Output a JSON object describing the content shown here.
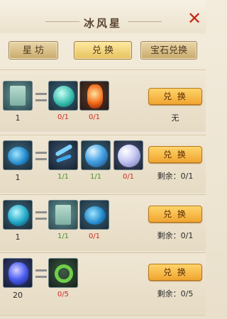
{
  "title": "冰风星",
  "close_icon": "close-icon",
  "tabs": [
    {
      "label": "星 坊"
    },
    {
      "label": "兑 换",
      "active": true
    },
    {
      "label": "宝石兑换"
    }
  ],
  "colors": {
    "accent": "#f0a530",
    "close": "#c62a16",
    "count_red": "#d22a20",
    "count_green": "#4a8d2a"
  },
  "rows": [
    {
      "result": {
        "icon": "jade-tablet-icon",
        "count": "1"
      },
      "materials": [
        {
          "icon": "teal-crystal-icon",
          "count": "0/1"
        },
        {
          "icon": "orange-flame-crystal-icon",
          "count": "0/1"
        }
      ],
      "button": "兑 换",
      "remain": "无"
    },
    {
      "result": {
        "icon": "blue-swirl-orb-icon",
        "count": "1"
      },
      "materials": [
        {
          "icon": "blue-dragon-icon",
          "count": "1/1"
        },
        {
          "icon": "blue-orb-icon",
          "count": "1/1"
        },
        {
          "icon": "pearl-orb-icon",
          "count": "0/1"
        }
      ],
      "button": "兑 换",
      "remain": "剩余：0/1"
    },
    {
      "result": {
        "icon": "teal-swirl-crystal-icon",
        "count": "1"
      },
      "materials": [
        {
          "icon": "jade-tablet-icon",
          "count": "1/1"
        },
        {
          "icon": "blue-swirl-orb-icon",
          "count": "0/1"
        }
      ],
      "button": "兑 换",
      "remain": "剩余：0/1"
    },
    {
      "result": {
        "icon": "blue-flame-gem-icon",
        "count": "20"
      },
      "materials": [
        {
          "icon": "green-dragon-icon",
          "count": "0/5"
        }
      ],
      "button": "兑 换",
      "remain": "剩余：0/5"
    }
  ]
}
